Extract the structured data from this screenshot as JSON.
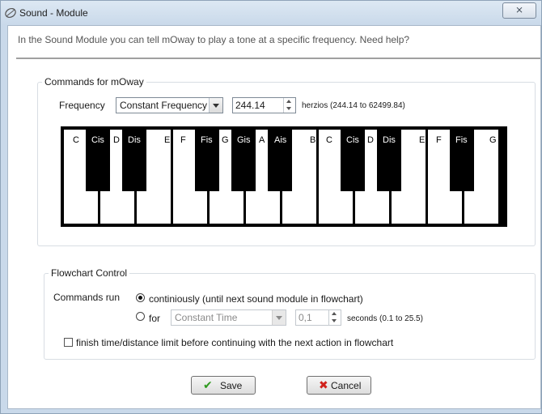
{
  "window": {
    "title": "Sound - Module",
    "close_label": "⨯"
  },
  "intro_text": "In the Sound Module you can tell mOway to play a tone at a specific frequency. Need help?",
  "commands": {
    "legend": "Commands for mOway",
    "frequency_label": "Frequency",
    "frequency_mode": "Constant Frequency",
    "frequency_value": "244.14",
    "frequency_unit": "herzios (244.14 to 62499.84)"
  },
  "piano": {
    "white_keys": [
      "C",
      "D",
      "E",
      "F",
      "G",
      "A",
      "B",
      "C",
      "D",
      "E",
      "F",
      "G"
    ],
    "black_keys": [
      "Cis",
      "Dis",
      "Fis",
      "Gis",
      "Ais",
      "Cis",
      "Dis",
      "Fis"
    ]
  },
  "flowchart": {
    "legend": "Flowchart Control",
    "commands_run_label": "Commands run",
    "option_continuous": "continiously (until next sound module in flowchart)",
    "option_for": "for",
    "time_mode": "Constant Time",
    "time_value": "0,1",
    "time_unit": "seconds (0.1 to 25.5)",
    "finish_checkbox": "finish time/distance limit before continuing with the next action in flowchart",
    "continuous_selected": true,
    "finish_checked": false
  },
  "buttons": {
    "save": "Save",
    "cancel": "Cancel"
  },
  "colors": {
    "save_icon": "#2e9a1e",
    "cancel_icon": "#d0201a"
  }
}
